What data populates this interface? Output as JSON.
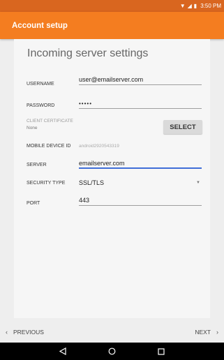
{
  "status_bar": {
    "time": "3:50 PM",
    "icons": [
      "wifi-icon",
      "signal-icon",
      "battery-icon"
    ]
  },
  "app_bar": {
    "title": "Account setup"
  },
  "form": {
    "heading": "Incoming server settings",
    "username": {
      "label": "USERNAME",
      "value": "user@emailserver.com"
    },
    "password": {
      "label": "PASSWORD",
      "value": "•••••"
    },
    "client_certificate": {
      "label": "CLIENT CERTIFICATE",
      "value": "None",
      "button": "SELECT"
    },
    "mobile_device_id": {
      "label": "MOBILE DEVICE ID",
      "value": "android2920543319"
    },
    "server": {
      "label": "SERVER",
      "value": "emailserver.com"
    },
    "security_type": {
      "label": "SECURITY TYPE",
      "value": "SSL/TLS"
    },
    "port": {
      "label": "PORT",
      "value": "443"
    }
  },
  "navigation": {
    "previous": "PREVIOUS",
    "next": "NEXT"
  },
  "system_nav": [
    "back-icon",
    "home-icon",
    "recents-icon"
  ],
  "colors": {
    "app_bar": "#f47d20",
    "status_bar": "#d9661f",
    "active_underline": "#3f6ed8"
  }
}
